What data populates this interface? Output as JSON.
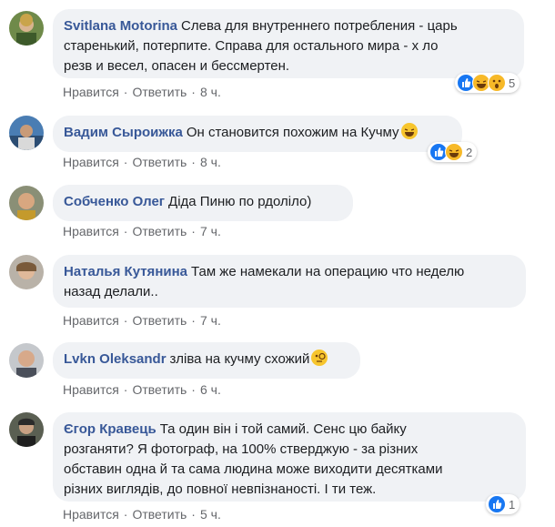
{
  "comments": [
    {
      "author": "Svitlana Motorina",
      "text_line1": "Слева для внутреннего потребления - царь",
      "text_line2": "старенький, потерпите. Справа для остального мира - х    ло",
      "text_line3": "резв и весел, опасен и бессмертен.",
      "like": "Нравится",
      "reply": "Ответить",
      "time": "8 ч.",
      "reaction_count": "5",
      "reactions": [
        "like-icon",
        "haha-icon",
        "wow-icon"
      ]
    },
    {
      "author": "Вадим Сыроижка",
      "text_line1": "Он становится похожим на Кучму",
      "like": "Нравится",
      "reply": "Ответить",
      "time": "8 ч.",
      "reaction_count": "2",
      "reactions": [
        "like-icon",
        "haha-icon"
      ]
    },
    {
      "author": "Собченко Олег",
      "text_line1": "Діда Пиню по    рдоліло)",
      "like": "Нравится",
      "reply": "Ответить",
      "time": "7 ч."
    },
    {
      "author": "Наталья Кутянина",
      "text_line1": "Там же намекали на операцию что неделю",
      "text_line2": "назад делали..",
      "like": "Нравится",
      "reply": "Ответить",
      "time": "7 ч."
    },
    {
      "author": "Lvkn Oleksandr",
      "text_line1": "зліва на кучму схожий",
      "like": "Нравится",
      "reply": "Ответить",
      "time": "6 ч."
    },
    {
      "author": "Єгор Кравець",
      "text_line1": "Та один він і той самий. Сенс цю байку",
      "text_line2": "розганяти? Я фотограф, на 100% стверджую - за різних",
      "text_line3": "обставин одна й та сама людина може виходити десятками",
      "text_line4": "різних виглядів, до повної невпізнаності. І ти теж.",
      "like": "Нравится",
      "reply": "Ответить",
      "time": "5 ч.",
      "reaction_count": "1",
      "reactions": [
        "like-icon"
      ]
    }
  ],
  "colors": {
    "author": "#385898",
    "bubble": "#f0f2f5",
    "meta": "#65676b",
    "like_blue": "#1877f2",
    "emoji_yellow": "#f7b928"
  }
}
